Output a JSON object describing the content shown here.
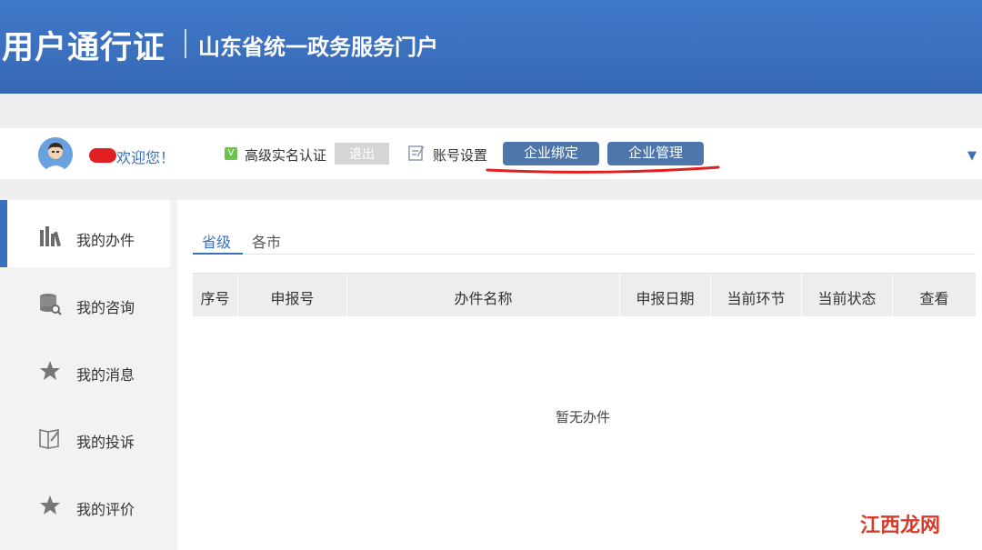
{
  "banner": {
    "title": "用户通行证",
    "subtitle": "山东省统一政务服务门户"
  },
  "userbar": {
    "welcome": "欢迎您！",
    "verify_icon_text": "V",
    "verify_text": "高级实名认证",
    "logout": "退出",
    "account_settings": "账号设置",
    "enterprise_bind": "企业绑定",
    "enterprise_manage": "企业管理",
    "dropdown_glyph": "▼"
  },
  "sidebar": {
    "items": [
      {
        "label": "我的办件",
        "icon": "books-icon",
        "active": true
      },
      {
        "label": "我的咨询",
        "icon": "database-search-icon"
      },
      {
        "label": "我的消息",
        "icon": "star-icon"
      },
      {
        "label": "我的投诉",
        "icon": "edit-book-icon"
      },
      {
        "label": "我的评价",
        "icon": "star-icon"
      }
    ]
  },
  "content": {
    "tabs": [
      {
        "label": "省级",
        "active": true
      },
      {
        "label": "各市"
      }
    ],
    "table_headers": [
      "序号",
      "申报号",
      "办件名称",
      "申报日期",
      "当前环节",
      "当前状态",
      "查看"
    ],
    "empty_text": "暂无办件"
  },
  "watermark": "江西龙网",
  "colors": {
    "brand_blue": "#3a6fbd",
    "button_blue": "#4f76aa",
    "annotation_red": "#e02020"
  }
}
